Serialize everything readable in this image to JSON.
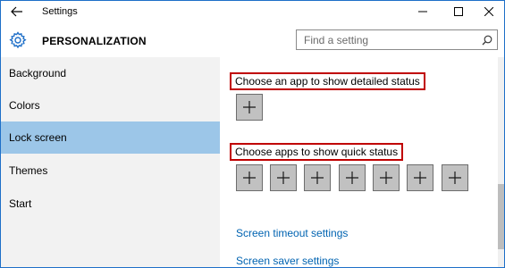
{
  "window": {
    "title": "Settings",
    "back_icon": "arrow-left-icon",
    "controls": [
      "minimize-icon",
      "maximize-icon",
      "close-icon"
    ]
  },
  "header": {
    "icon": "gear-icon",
    "title": "PERSONALIZATION",
    "search": {
      "placeholder": "Find a setting",
      "value": "",
      "icon": "search-icon"
    }
  },
  "sidebar": {
    "items": [
      {
        "label": "Background",
        "selected": false
      },
      {
        "label": "Colors",
        "selected": false
      },
      {
        "label": "Lock screen",
        "selected": true
      },
      {
        "label": "Themes",
        "selected": false
      },
      {
        "label": "Start",
        "selected": false
      }
    ]
  },
  "main": {
    "detailed_status_label": "Choose an app to show detailed status",
    "quick_status_label": "Choose apps to show quick status",
    "detailed_slots": 1,
    "quick_slots": 7,
    "links": {
      "screen_timeout": "Screen timeout settings",
      "screen_saver": "Screen saver settings"
    }
  },
  "colors": {
    "accent_selected": "#9cc6e8",
    "link": "#0063b1",
    "highlight_box": "#c00000",
    "sidebar_bg": "#f2f2f2",
    "tile_bg": "#c1c1c1"
  }
}
